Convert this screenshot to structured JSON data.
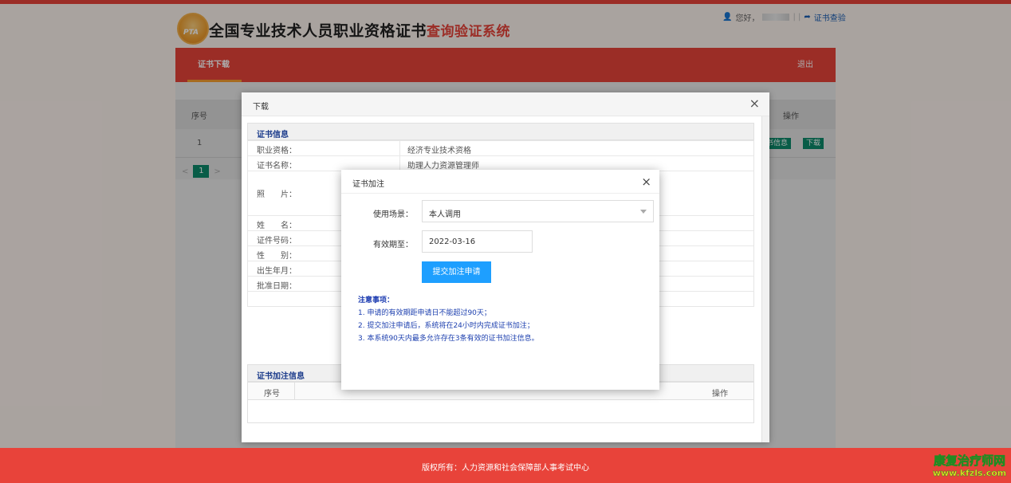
{
  "header": {
    "logo_text": "PTA",
    "title_main": "全国专业技术人员职业资格证书",
    "title_sub": "查询验证系统",
    "greeting": "您好，",
    "verify_link": "证书查验"
  },
  "nav": {
    "active_tab": "证书下载",
    "logout": "退出"
  },
  "background_table": {
    "col_seq": "序号",
    "col_op": "操作",
    "row_seq": "1",
    "btn_info": "书信息",
    "btn_download": "下载",
    "pager_current": "1",
    "pager_prev": "<",
    "pager_next": ">"
  },
  "download_modal": {
    "title": "下载",
    "close": "×",
    "section_cert_info": "证书信息",
    "fields": [
      {
        "label": "职业资格：",
        "value": "经济专业技术资格"
      },
      {
        "label": "证书名称：",
        "value": "助理人力资源管理师"
      },
      {
        "label": "照　　片：",
        "value": ""
      },
      {
        "label": "姓　　名：",
        "value": ""
      },
      {
        "label": "证件号码：",
        "value": ""
      },
      {
        "label": "性　　别：",
        "value": ""
      },
      {
        "label": "出生年月：",
        "value": ""
      },
      {
        "label": "批准日期：",
        "value": ""
      }
    ],
    "section_annotation": "证书加注信息",
    "annotation_col_seq": "序号",
    "annotation_col_op": "操作"
  },
  "annotation_modal": {
    "title": "证书加注",
    "close": "×",
    "scene_label": "使用场景：",
    "scene_value": "本人调用",
    "valid_label": "有效期至：",
    "valid_value": "2022-03-16",
    "submit": "提交加注申请",
    "notes_title": "注意事项：",
    "notes": [
      "1. 申请的有效期距申请日不能超过90天；",
      "2. 提交加注申请后，系统将在24小时内完成证书加注；",
      "3. 本系统90天内最多允许存在3条有效的证书加注信息。"
    ]
  },
  "footer": {
    "copyright": "版权所有：人力资源和社会保障部人事考试中心"
  },
  "watermark": {
    "cn": "康复治疗师网",
    "en": "www.kfzls.com"
  },
  "colors": {
    "brand_red": "#e8433a",
    "action_green": "#0d8a6a",
    "submit_blue": "#1e9fff",
    "notes_blue": "#1e40af"
  }
}
